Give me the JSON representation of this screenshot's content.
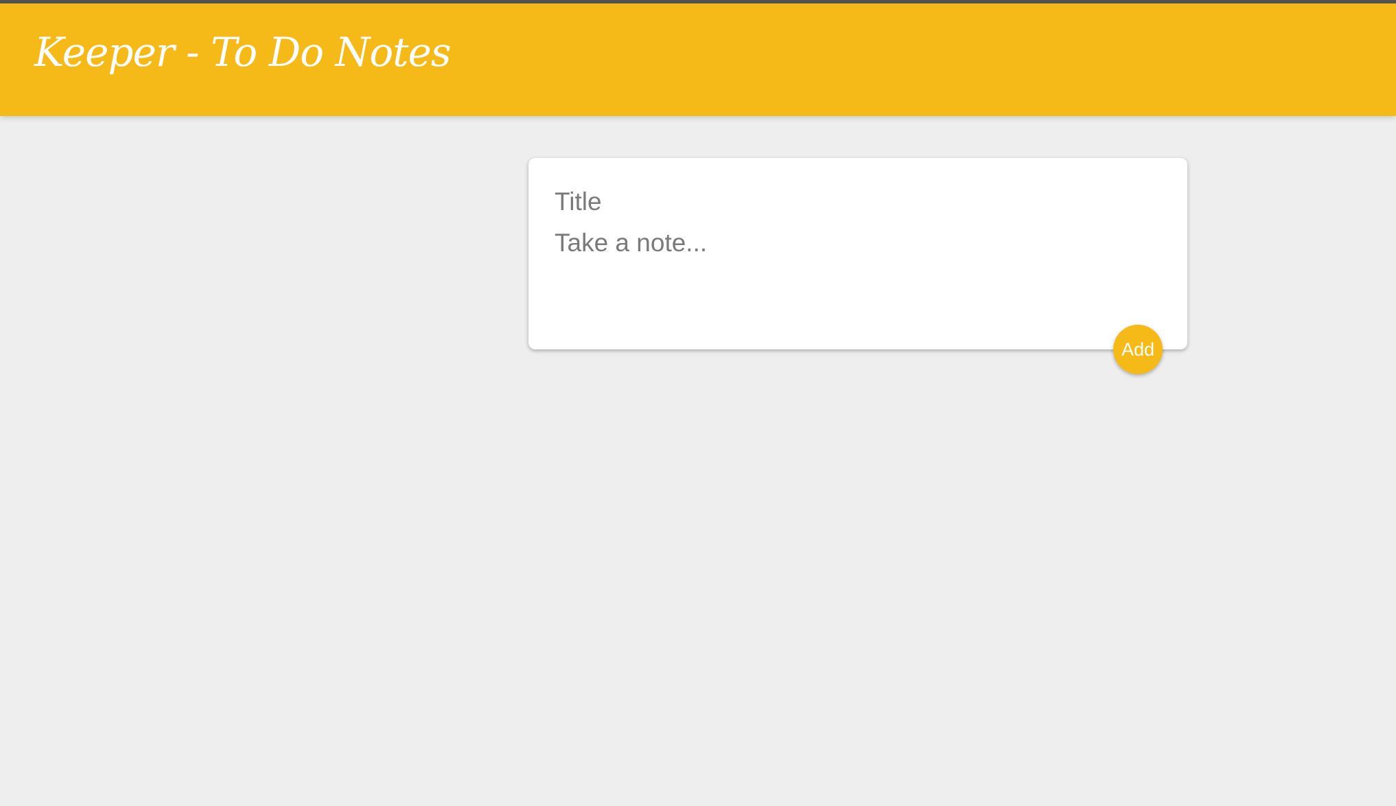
{
  "colors": {
    "header_bg": "#f5ba18",
    "page_bg": "#eeeeee",
    "accent": "#f5ba18",
    "card_bg": "#ffffff"
  },
  "header": {
    "title": "Keeper - To Do Notes"
  },
  "note_form": {
    "title_placeholder": "Title",
    "title_value": "",
    "content_placeholder": "Take a note...",
    "content_value": "",
    "add_label": "Add"
  }
}
